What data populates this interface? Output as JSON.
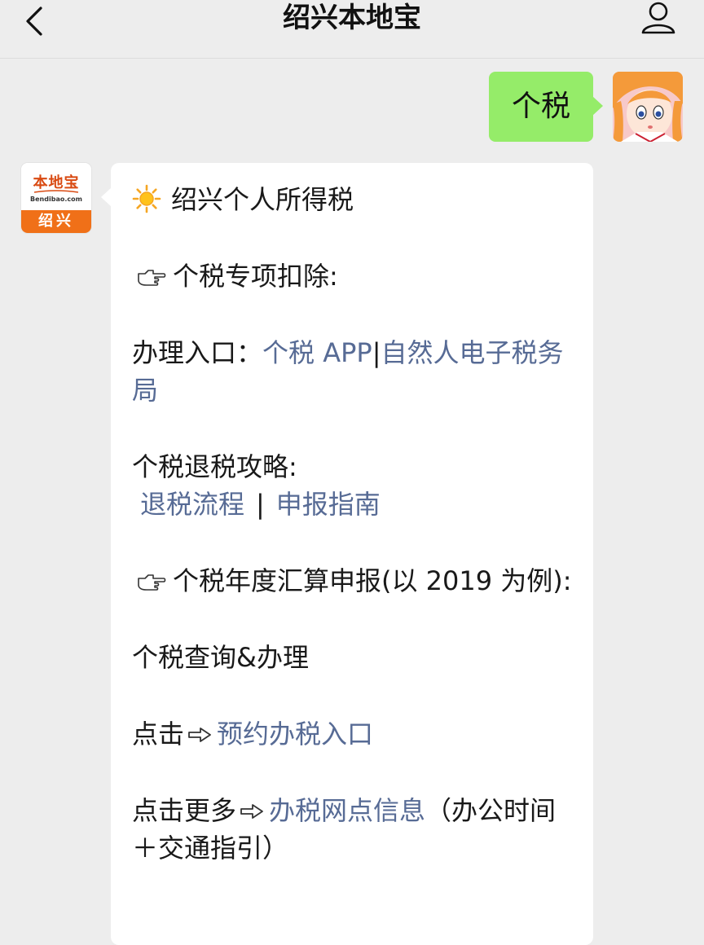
{
  "header": {
    "title": "绍兴本地宝",
    "back_icon": "back-chevron-icon",
    "profile_icon": "user-profile-icon"
  },
  "user_message": {
    "text": "个税",
    "bubble_color": "#95ec69"
  },
  "bot_avatar": {
    "logo_text": "本地宝",
    "logo_sub": "Bendibao.com",
    "city": "绍兴"
  },
  "bot_message": {
    "heading": "绍兴个人所得税",
    "section1_title": "个税专项扣除:",
    "entry_label": "办理入口：",
    "entry_link1": "个税 APP",
    "entry_sep": "|",
    "entry_link2": "自然人电子税务局",
    "refund_label": "个税退税攻略:",
    "refund_link1": "退税流程",
    "refund_sep": "|",
    "refund_link2": "申报指南",
    "section2_title": "个税年度汇算申报(以 2019 为例):",
    "query_label": "个税查询&办理",
    "click_label": "点击",
    "appointment_link": "预约办税入口",
    "more_label": "点击更多",
    "outlet_link": "办税网点信息",
    "outlet_suffix": "（办公时间＋交通指引）",
    "link_color": "#576b95"
  }
}
